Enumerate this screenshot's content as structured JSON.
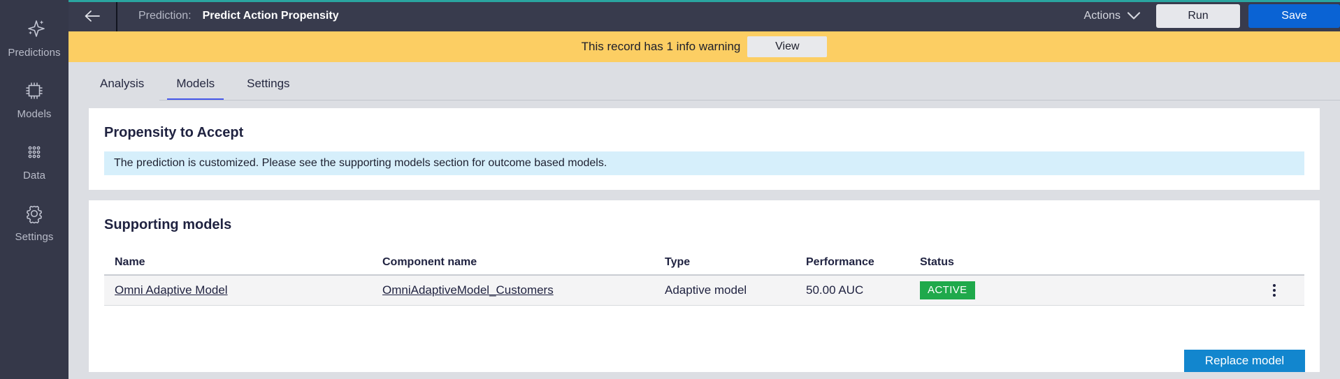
{
  "theme": {
    "sidebar_bg": "#353849",
    "header_bg": "#383b4d",
    "accent_teal": "#2aa5a0",
    "warning_bg": "#fcce63",
    "page_bg": "#dcdee3",
    "tab_active": "#4758ea",
    "primary_blue": "#0a63d4",
    "info_bg": "#d6effb",
    "status_green": "#1fa94b",
    "tooltip_blue": "#1286ce"
  },
  "sidebar": {
    "items": [
      {
        "label": "Predictions",
        "icon": "sparkle-icon"
      },
      {
        "label": "Models",
        "icon": "chip-icon"
      },
      {
        "label": "Data",
        "icon": "dots-grid-icon"
      },
      {
        "label": "Settings",
        "icon": "gear-icon"
      }
    ]
  },
  "header": {
    "back_icon": "back-arrow-icon",
    "label": "Prediction:",
    "title": "Predict Action Propensity",
    "actions_menu": "Actions",
    "actions_caret_icon": "chevron-down-icon",
    "run_label": "Run",
    "save_label": "Save"
  },
  "warning": {
    "text": "This record has 1 info warning",
    "button_label": "View"
  },
  "tabs": [
    {
      "label": "Analysis",
      "active": false
    },
    {
      "label": "Models",
      "active": true
    },
    {
      "label": "Settings",
      "active": false
    }
  ],
  "propensity_card": {
    "title": "Propensity to Accept",
    "info_message": "The prediction is customized. Please see the supporting models section for outcome based models."
  },
  "supporting_card": {
    "title": "Supporting models",
    "columns": [
      "Name",
      "Component name",
      "Type",
      "Performance",
      "Status"
    ],
    "rows": [
      {
        "name": "Omni Adaptive Model",
        "component_name": "OmniAdaptiveModel_Customers",
        "type": "Adaptive model",
        "performance": "50.00 AUC",
        "status": "ACTIVE",
        "menu_icon": "kebab-menu-icon"
      }
    ]
  },
  "context_menu": {
    "replace_model": "Replace model"
  }
}
